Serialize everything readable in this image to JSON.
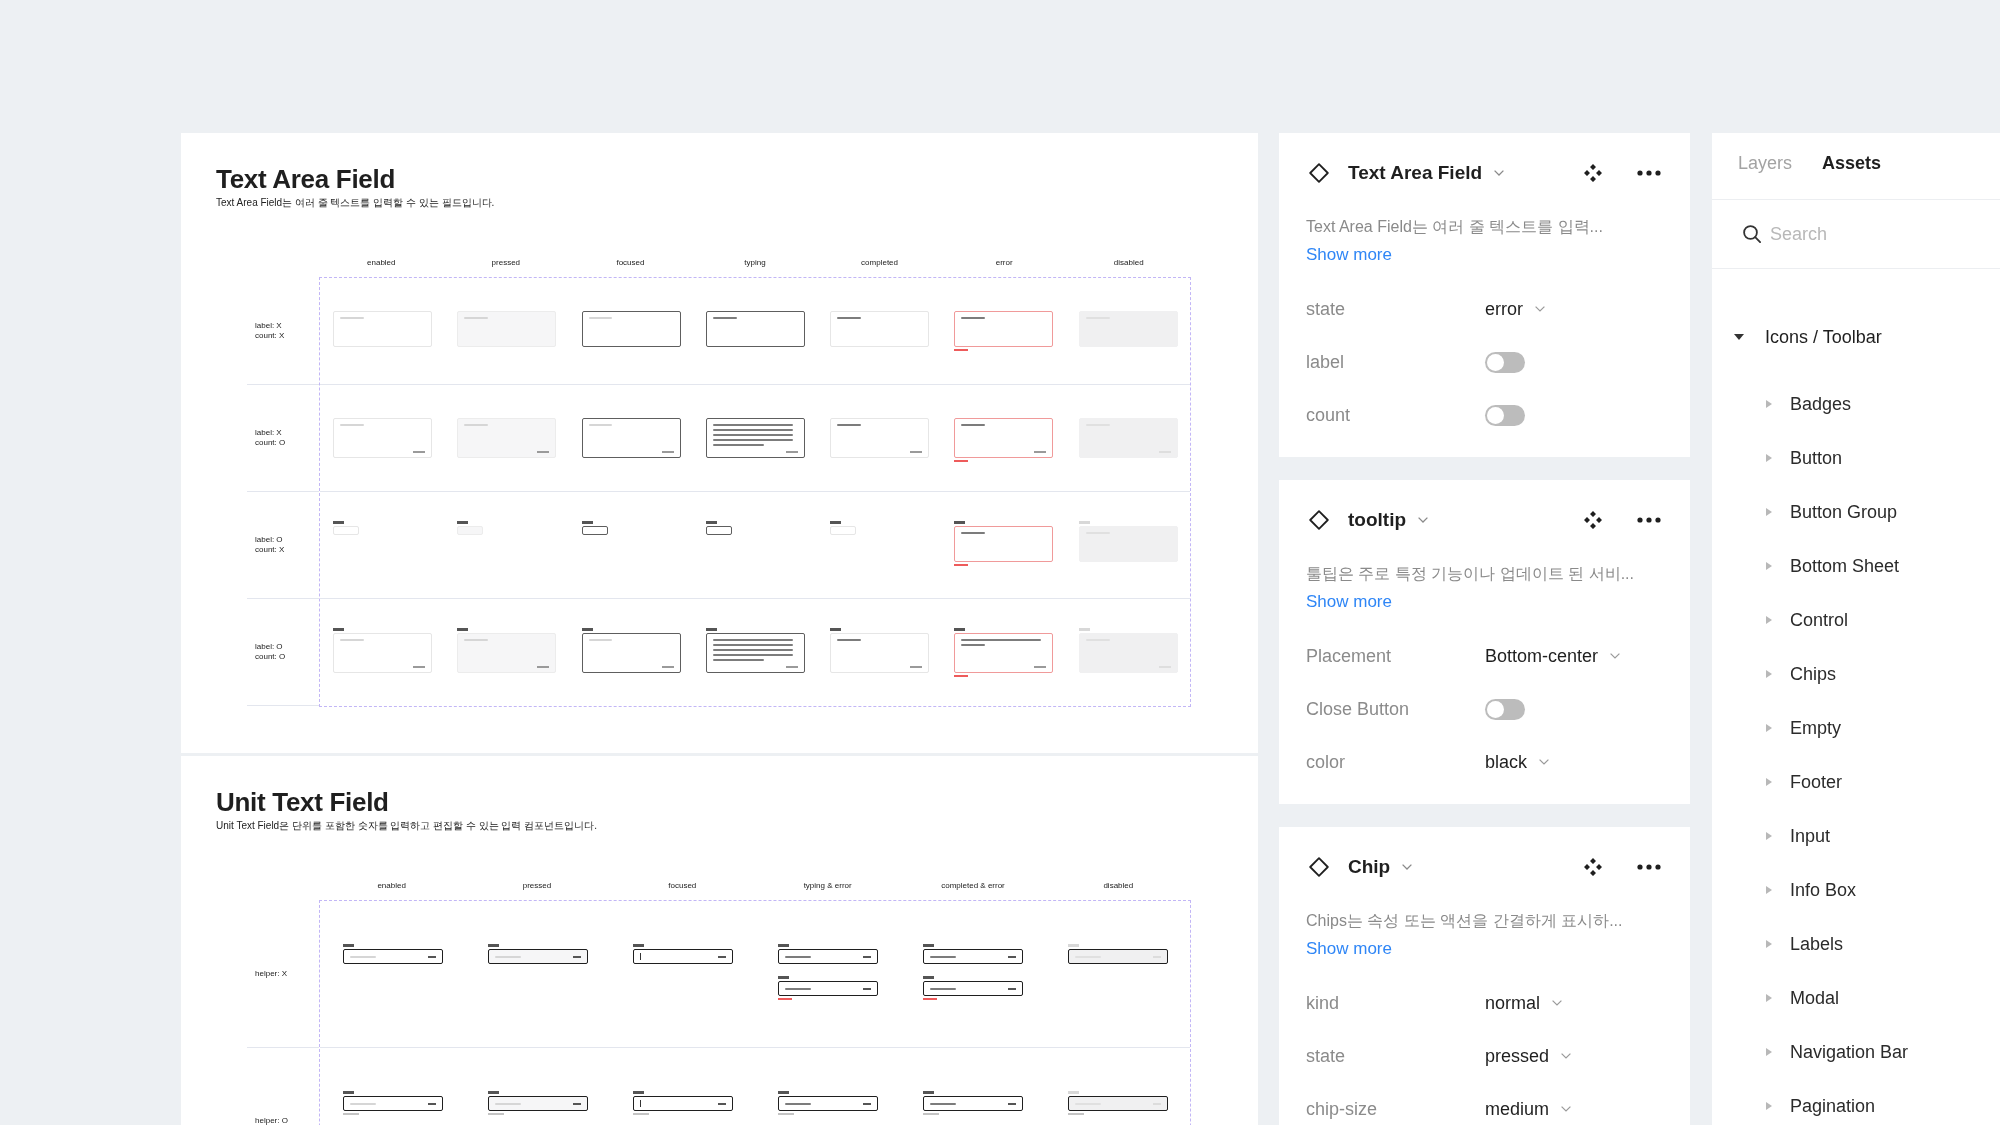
{
  "canvas": {
    "sections": [
      {
        "kind": "text_area",
        "title": "Text Area Field",
        "description": "Text Area Field는 여러 줄 텍스트를 입력할 수 있는 필드입니다.",
        "columns": [
          "enabled",
          "pressed",
          "focused",
          "typing",
          "completed",
          "error",
          "disabled"
        ],
        "rows": [
          {
            "caption": [
              "label: X",
              "count: X"
            ],
            "show_label": false,
            "show_count": false,
            "cells": [
              {
                "kind": "enabled",
                "collapsed": false
              },
              {
                "kind": "pressed",
                "collapsed": false
              },
              {
                "kind": "focused",
                "collapsed": false
              },
              {
                "kind": "typing",
                "collapsed": false
              },
              {
                "kind": "completed",
                "collapsed": false
              },
              {
                "kind": "error",
                "collapsed": false
              },
              {
                "kind": "disabled",
                "collapsed": false
              }
            ]
          },
          {
            "caption": [
              "label: X",
              "count: O"
            ],
            "show_label": false,
            "show_count": true,
            "cells": [
              {
                "kind": "enabled",
                "collapsed": false
              },
              {
                "kind": "pressed",
                "collapsed": false
              },
              {
                "kind": "focused",
                "collapsed": false
              },
              {
                "kind": "typing_long",
                "collapsed": false
              },
              {
                "kind": "completed",
                "collapsed": false
              },
              {
                "kind": "error",
                "collapsed": false
              },
              {
                "kind": "disabled",
                "collapsed": false
              }
            ]
          },
          {
            "caption": [
              "label: O",
              "count: X"
            ],
            "show_label": true,
            "show_count": false,
            "cells": [
              {
                "kind": "enabled",
                "collapsed": true
              },
              {
                "kind": "pressed",
                "collapsed": true
              },
              {
                "kind": "focused",
                "collapsed": true
              },
              {
                "kind": "typing",
                "collapsed": true
              },
              {
                "kind": "completed",
                "collapsed": true
              },
              {
                "kind": "error",
                "collapsed": false
              },
              {
                "kind": "disabled",
                "collapsed": false
              }
            ]
          },
          {
            "caption": [
              "label: O",
              "count: O"
            ],
            "show_label": true,
            "show_count": true,
            "cells": [
              {
                "kind": "enabled",
                "collapsed": false
              },
              {
                "kind": "pressed",
                "collapsed": false
              },
              {
                "kind": "focused",
                "collapsed": false
              },
              {
                "kind": "typing_long",
                "collapsed": false
              },
              {
                "kind": "completed",
                "collapsed": false
              },
              {
                "kind": "error_long",
                "collapsed": false
              },
              {
                "kind": "disabled",
                "collapsed": false
              }
            ]
          }
        ]
      },
      {
        "kind": "unit",
        "title": "Unit Text Field",
        "description": "Unit Text Field은 단위를 포함한 숫자를 입력하고 편집할 수 있는 입력 컴포넌트입니다.",
        "columns": [
          "enabled",
          "pressed",
          "focused",
          "typing & error",
          "completed & error",
          "disabled"
        ],
        "rows": [
          {
            "caption": [
              "helper: X"
            ],
            "show_helper": false,
            "cells": [
              {
                "fields": [
                  {
                    "kind": "enabled"
                  }
                ]
              },
              {
                "fields": [
                  {
                    "kind": "pressed"
                  }
                ]
              },
              {
                "fields": [
                  {
                    "kind": "focused"
                  }
                ]
              },
              {
                "fields": [
                  {
                    "kind": "typing"
                  },
                  {
                    "kind": "typing_error"
                  }
                ]
              },
              {
                "fields": [
                  {
                    "kind": "completed"
                  },
                  {
                    "kind": "completed_error"
                  }
                ]
              },
              {
                "fields": [
                  {
                    "kind": "disabled"
                  }
                ]
              }
            ]
          },
          {
            "caption": [
              "helper: O"
            ],
            "show_helper": true,
            "cells": [
              {
                "fields": [
                  {
                    "kind": "enabled"
                  }
                ]
              },
              {
                "fields": [
                  {
                    "kind": "pressed"
                  }
                ]
              },
              {
                "fields": [
                  {
                    "kind": "focused"
                  }
                ]
              },
              {
                "fields": [
                  {
                    "kind": "typing"
                  }
                ]
              },
              {
                "fields": [
                  {
                    "kind": "completed"
                  }
                ]
              },
              {
                "fields": [
                  {
                    "kind": "disabled"
                  }
                ]
              }
            ]
          }
        ]
      }
    ]
  },
  "properties_panel": {
    "cards": [
      {
        "title": "Text Area Field",
        "description": "Text Area Field는 여러 줄 텍스트를 입력...",
        "link": "Show more",
        "properties": [
          {
            "kind": "dropdown",
            "name": "state",
            "value": "error"
          },
          {
            "kind": "toggle",
            "name": "label",
            "on": false
          },
          {
            "kind": "toggle",
            "name": "count",
            "on": false
          }
        ]
      },
      {
        "title": "tooltip",
        "description": "툴팁은 주로 특정 기능이나 업데이트 된 서비...",
        "link": "Show more",
        "properties": [
          {
            "kind": "dropdown",
            "name": "Placement",
            "value": "Bottom-center"
          },
          {
            "kind": "toggle",
            "name": "Close Button",
            "on": false
          },
          {
            "kind": "dropdown",
            "name": "color",
            "value": "black"
          }
        ]
      },
      {
        "title": "Chip",
        "description": "Chips는 속성 또는 액션을 간결하게 표시하...",
        "link": "Show more",
        "properties": [
          {
            "kind": "dropdown",
            "name": "kind",
            "value": "normal"
          },
          {
            "kind": "dropdown",
            "name": "state",
            "value": "pressed"
          },
          {
            "kind": "dropdown",
            "name": "chip-size",
            "value": "medium"
          }
        ]
      }
    ]
  },
  "assets_panel": {
    "tabs": [
      {
        "label": "Layers",
        "selected": false
      },
      {
        "label": "Assets",
        "selected": true
      }
    ],
    "search": {
      "placeholder": "Search"
    },
    "tree": [
      {
        "label": "Icons / Toolbar",
        "expanded": true,
        "children": [
          {
            "label": "Badges",
            "expanded": false
          },
          {
            "label": "Button",
            "expanded": false
          },
          {
            "label": "Button Group",
            "expanded": false
          },
          {
            "label": "Bottom Sheet",
            "expanded": false
          },
          {
            "label": "Control",
            "expanded": false
          },
          {
            "label": "Chips",
            "expanded": false
          },
          {
            "label": "Empty",
            "expanded": false
          },
          {
            "label": "Footer",
            "expanded": false
          },
          {
            "label": "Input",
            "expanded": false
          },
          {
            "label": "Info Box",
            "expanded": false
          },
          {
            "label": "Labels",
            "expanded": false
          },
          {
            "label": "Modal",
            "expanded": false
          },
          {
            "label": "Navigation Bar",
            "expanded": false
          },
          {
            "label": "Pagination",
            "expanded": false
          }
        ]
      }
    ]
  }
}
